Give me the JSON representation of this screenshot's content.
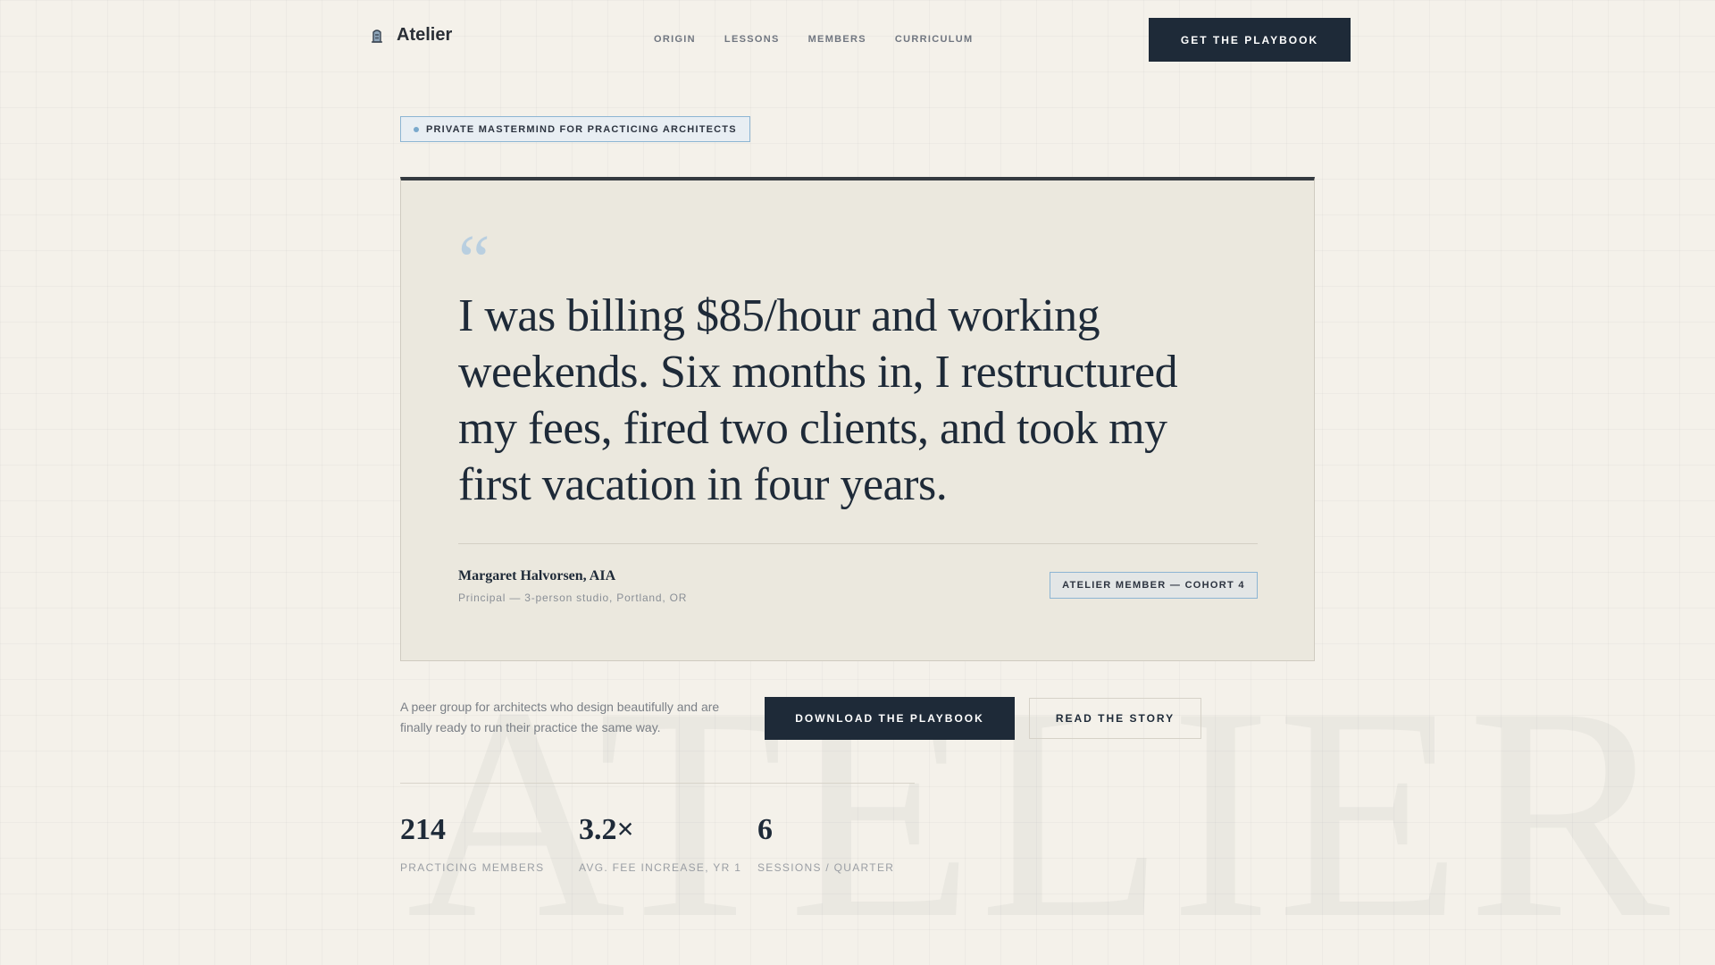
{
  "brand": {
    "name": "Atelier",
    "icon": "building-icon",
    "watermark": "ATELIER"
  },
  "nav": {
    "items": [
      "ORIGIN",
      "LESSONS",
      "MEMBERS",
      "CURRICULUM"
    ]
  },
  "header": {
    "cta_label": "GET THE PLAYBOOK"
  },
  "hero": {
    "eyebrow": "PRIVATE MASTERMIND FOR PRACTICING ARCHITECTS"
  },
  "testimonial": {
    "quote_mark": "“",
    "quote": "I was billing $85/hour and working weekends. Six months in, I restructured my fees, fired two clients, and took my first vacation in four years.",
    "author_name": "Margaret Halvorsen, AIA",
    "author_role": "Principal — 3-person studio, Portland, OR",
    "member_badge": "ATELIER MEMBER — COHORT 4"
  },
  "intro": {
    "tagline": "A peer group for architects who design beautifully and are finally ready to run their practice the same way.",
    "primary_label": "DOWNLOAD THE PLAYBOOK",
    "secondary_label": "READ THE STORY"
  },
  "stats": [
    {
      "value": "214",
      "label": "PRACTICING MEMBERS"
    },
    {
      "value": "3.2×",
      "label": "AVG. FEE INCREASE, YR 1"
    },
    {
      "value": "6",
      "label": "SESSIONS / QUARTER"
    }
  ],
  "colors": {
    "ink": "#1e2a38",
    "accent": "#8db5d3",
    "background": "#f4f1ea",
    "card": "#ebe8de"
  }
}
